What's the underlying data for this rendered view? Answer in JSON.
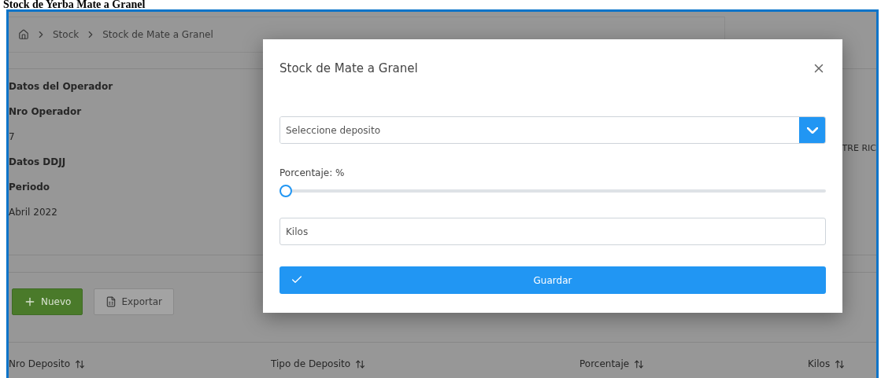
{
  "page_title": "Stock de Yerba Mate a Granel",
  "breadcrumb": [
    "Stock",
    "Stock de Mate a Granel"
  ],
  "operator": {
    "heading": "Datos del Operador",
    "number_label": "Nro Operador",
    "number_value": "7"
  },
  "ddjj": {
    "heading": "Datos DDJJ",
    "period_label": "Periodo",
    "period_value": "Abril 2022"
  },
  "side_text": "TRE RIC",
  "toolbar": [
    {
      "kind": "new",
      "label": "Nuevo"
    },
    {
      "kind": "export",
      "label": "Exportar"
    }
  ],
  "table": {
    "columns": [
      "Nro Deposito",
      "Tipo de Deposito",
      "Porcentaje",
      "Kilos"
    ]
  },
  "modal": {
    "title": "Stock de Mate a Granel",
    "select": {
      "placeholder": "Seleccione deposito"
    },
    "slider": {
      "label": "Porcentaje: %",
      "level": 0
    },
    "kilos": {
      "placeholder": "Kilos"
    },
    "save": "Guardar"
  }
}
